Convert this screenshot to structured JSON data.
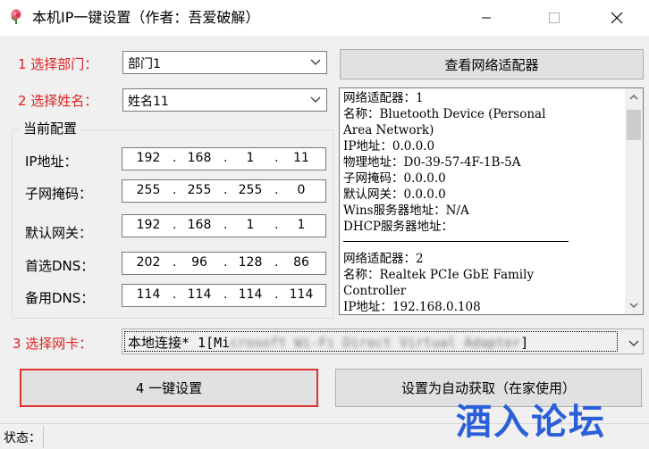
{
  "window": {
    "title": "本机IP一键设置（作者：吾爱破解）",
    "app_icon": "rose-icon",
    "controls": [
      "minimize-icon",
      "maximize-icon",
      "close-icon"
    ]
  },
  "department": {
    "label": "1  选择部门：",
    "value": "部门1"
  },
  "name": {
    "label": "2  选择姓名：",
    "value": "姓名11"
  },
  "view_adapters_button": "查看网络适配器",
  "current_config": {
    "title": "当前配置",
    "ip": {
      "label": "IP地址：",
      "octets": [
        "192",
        "168",
        "1",
        "11"
      ]
    },
    "mask": {
      "label": "子网掩码：",
      "octets": [
        "255",
        "255",
        "255",
        "0"
      ]
    },
    "gateway": {
      "label": "默认网关：",
      "octets": [
        "192",
        "168",
        "1",
        "1"
      ]
    },
    "dns1": {
      "label": "首选DNS：",
      "octets": [
        "202",
        "96",
        "128",
        "86"
      ]
    },
    "dns2": {
      "label": "备用DNS：",
      "octets": [
        "114",
        "114",
        "114",
        "114"
      ]
    }
  },
  "adapter_info": {
    "block1": "网络适配器：1\n名称：Bluetooth Device (Personal\nArea Network)\nIP地址：0.0.0.0\n物理地址：D0-39-57-4F-1B-5A\n子网掩码：0.0.0.0\n默认网关：0.0.0.0\nWins服务器地址：N/A\nDHCP服务器地址：",
    "block2": "网络适配器：2\n名称：Realtek PCIe GbE Family\nController\nIP地址：192.168.0.108"
  },
  "nic": {
    "label": "3  选择网卡：",
    "value_prefix": "本地连接* 1[Mi",
    "value_obscured": "crosoft Wi-Fi Direct Virtual Adapter",
    "value_suffix": "]"
  },
  "one_click_button": "4  一键设置",
  "auto_button": "设置为自动获取（在家使用）",
  "status": {
    "label": "状态："
  },
  "watermark": "酒入论坛",
  "colors": {
    "accent_red": "#e02020",
    "watermark_blue": "#2b5fd9"
  }
}
